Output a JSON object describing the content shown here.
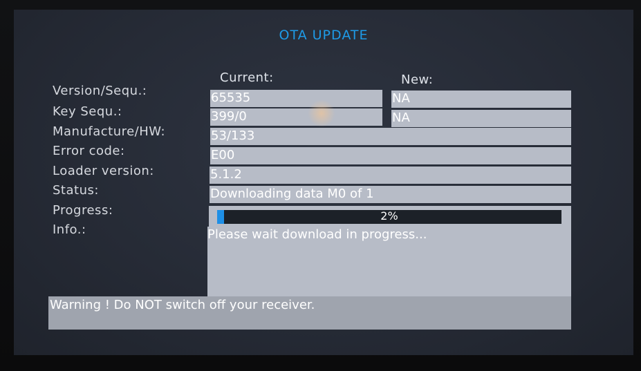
{
  "screen": {
    "title": "OTA UPDATE",
    "accent_color": "#1e9be8",
    "panel_color": "#b7bcc7"
  },
  "columns": {
    "current": "Current:",
    "new": "New:"
  },
  "rows": {
    "version": {
      "label": "Version/Sequ.:",
      "current": "65535",
      "new": "NA"
    },
    "key": {
      "label": "Key Sequ.:",
      "current": "399/0",
      "new": "NA"
    },
    "manufacture": {
      "label": "Manufacture/HW:",
      "value": "53/133"
    },
    "error": {
      "label": "Error code:",
      "value": "E00"
    },
    "loader": {
      "label": "Loader version:",
      "value": "5.1.2"
    },
    "status": {
      "label": "Status:",
      "value": "Downloading data M0 of 1"
    },
    "progress": {
      "label": "Progress:",
      "percent_text": "2%",
      "fraction": 0.02
    },
    "info": {
      "label": "Info.:",
      "value": "Please wait download in progress..."
    }
  },
  "warning": "Warning ! Do NOT switch off your receiver."
}
